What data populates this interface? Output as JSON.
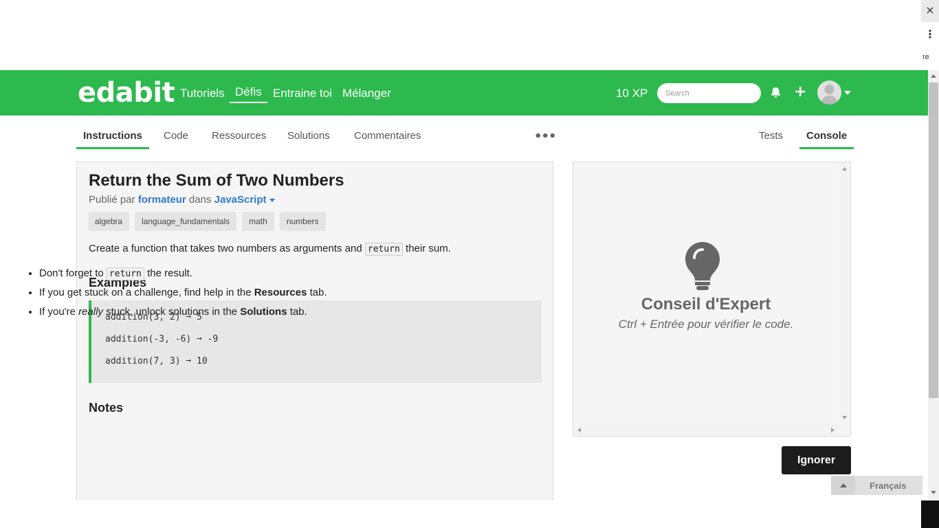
{
  "browser": {
    "close_glyph": "×",
    "menu_glyph": "⋮",
    "side_text": "re"
  },
  "header": {
    "logo": "edabit",
    "nav": [
      "Tutoriels",
      "Défis",
      "Entraine toi",
      "Mélanger"
    ],
    "active_nav": "Défis",
    "xp": "10 XP",
    "search_placeholder": "Search",
    "plus": "+"
  },
  "tabs": {
    "left": [
      "Instructions",
      "Code",
      "Ressources",
      "Solutions",
      "Commentaires"
    ],
    "more": "•••",
    "right": [
      "Tests",
      "Console"
    ]
  },
  "challenge": {
    "title": "Return the Sum of Two Numbers",
    "published_by": "Publié par",
    "author": "formateur",
    "in_word": "dans",
    "language": "JavaScript",
    "tags": [
      "algebra",
      "language_fundamentals",
      "math",
      "numbers"
    ],
    "desc_before": "Create a function that takes two numbers as arguments and",
    "desc_code": "return",
    "desc_after": "their sum.",
    "examples_heading": "Examples",
    "examples": [
      "addition(3, 2) ➞ 5",
      "addition(-3, -6) ➞ -9",
      "addition(7, 3) ➞ 10"
    ],
    "notes_heading": "Notes",
    "note1_before": "Don't forget to",
    "note1_code": "return",
    "note1_after": "the result.",
    "note2_before": "If you get stuck on a challenge, find help in the",
    "note2_bold": "Resources",
    "note2_after": "tab.",
    "note3_before": "If you're",
    "note3_italic": "really",
    "note3_middle": "stuck, unlock solutions in the",
    "note3_bold": "Solutions",
    "note3_after": "tab."
  },
  "console": {
    "tip_title": "Conseil d'Expert",
    "tip_text": "Ctrl + Entrée pour vérifier le code."
  },
  "ignore_button": "Ignorer",
  "language_selector": "Français",
  "colors": {
    "brand_green": "#2db94d",
    "link_blue": "#2f7ad1",
    "button_dark": "#1c1c1c"
  }
}
